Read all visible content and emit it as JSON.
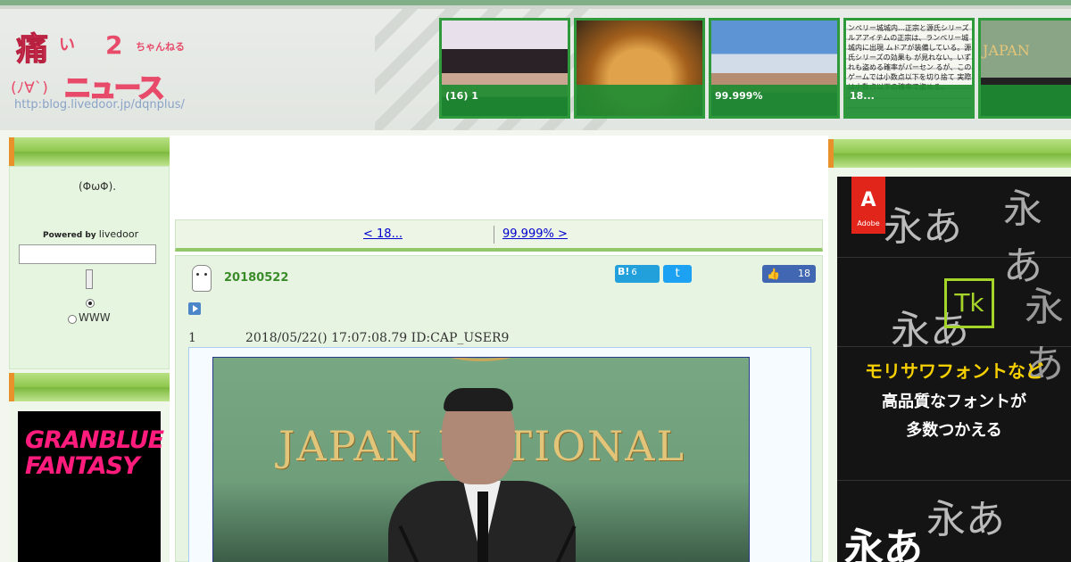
{
  "header": {
    "logo": {
      "kanji": "痛",
      "small1": "い",
      "two": "2",
      "chan": "ちゃんねる",
      "face": "(ﾉ∀`)",
      "news": "ニュース",
      "url": "http:blog.livedoor.jp/dqnplus/"
    },
    "thumbs": [
      {
        "caption": "(16) 1"
      },
      {
        "caption": ""
      },
      {
        "caption": "99.999%"
      },
      {
        "caption": "18..."
      },
      {
        "caption": ""
      }
    ],
    "thumb4_text": "ンペリー城城内…正宗と源氏シリーズ ルアアイテムの正宗は、ランペリー城城内に出現 ムドアが装備している。源氏シリーズの効果も が見れない。いずれも盗める確率がパーセン るが、このゲームでは小数点以下を切り捨て 実際は小数点以下の確率で盗める。",
    "thumb5_text": "JAPAN"
  },
  "left_sidebar": {
    "face_emoticon": "(ΦωΦ).",
    "powered_by": "Powered by",
    "livedoor": "livedoor",
    "search_value": "",
    "radio_www_label": "WWW",
    "ad_text": "GRANBLUE FANTASY"
  },
  "nav": {
    "prev_label": "< 18...",
    "next_label": "99.999% >"
  },
  "article": {
    "date": "20180522",
    "hatena_label": "B!",
    "hatena_count": "6",
    "tweet_label": "t",
    "like_count": "18",
    "res_number": "1",
    "res_meta": "2018/05/22() 17:07:08.79 ID:CAP_USER9",
    "photo_sign": "JAPAN NATIONAL"
  },
  "right_ad": {
    "brand": "Adobe",
    "tk": "Tk",
    "line1": "モリサワフォントなど",
    "line2": "高品質なフォントが",
    "line3": "多数つかえる",
    "glyph": "永あ"
  },
  "colors": {
    "accent_green": "#2f9a3b",
    "link": "#0000cc",
    "logo_pink": "#e84a6a"
  }
}
